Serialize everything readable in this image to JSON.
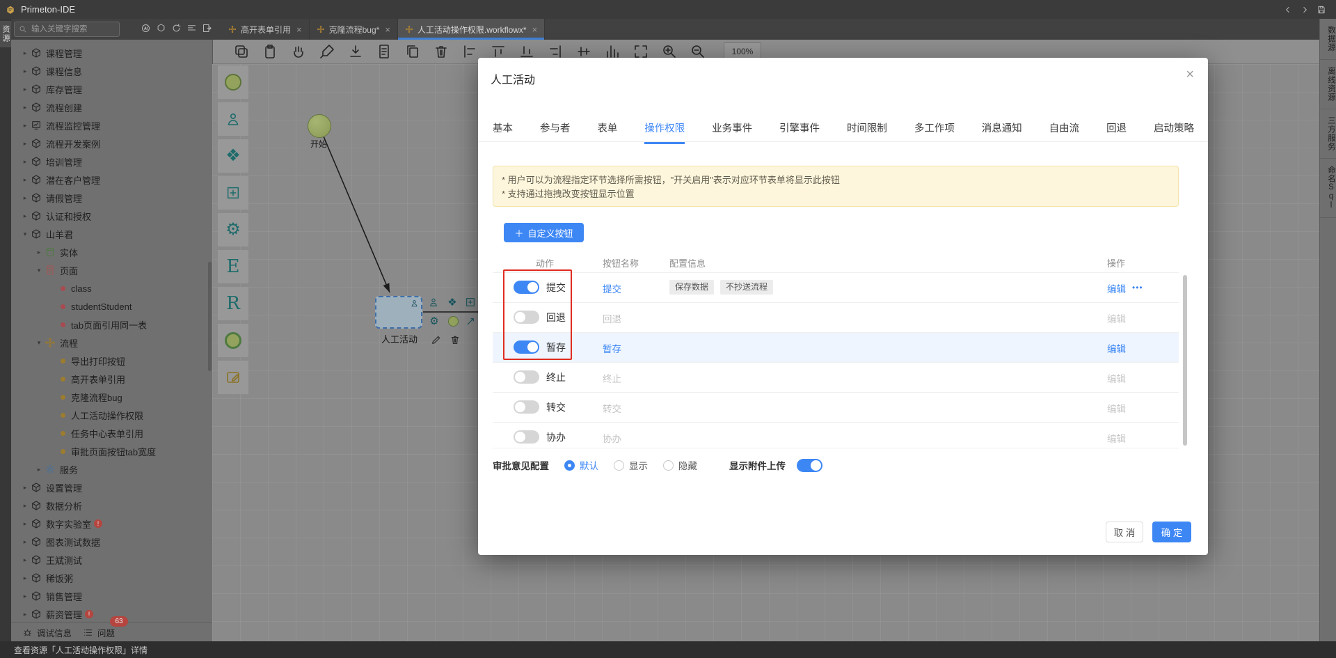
{
  "app": {
    "title": "Primeton-IDE"
  },
  "search": {
    "placeholder": "输入关键字搜索"
  },
  "quick_icons": [
    "ai-icon",
    "hexagon-icon",
    "refresh-icon",
    "outline-icon",
    "export-icon"
  ],
  "editor_tabs": [
    {
      "label": "高开表单引用",
      "active": false
    },
    {
      "label": "克隆流程bug*",
      "active": false
    },
    {
      "label": "人工活动操作权限.workflowx*",
      "active": true
    }
  ],
  "toolbar": {
    "icons": [
      "duplicate-icon",
      "clipboard-icon",
      "hand-icon",
      "brush-icon",
      "download-icon",
      "document-icon",
      "copy-icon",
      "trash-icon",
      "align-left-icon",
      "align-top-icon",
      "align-bottom-icon",
      "align-right-icon",
      "align-middle-icon",
      "distribute-icon",
      "fit-screen-icon",
      "zoom-in-icon",
      "zoom-out-icon"
    ],
    "zoom_level": "100%"
  },
  "left_rail": {
    "active_tab": "资源"
  },
  "sidebar": {
    "items": [
      {
        "level": 0,
        "caret": "r",
        "icon": "cube",
        "label": "课程管理"
      },
      {
        "level": 0,
        "caret": "r",
        "icon": "cube",
        "label": "课程信息"
      },
      {
        "level": 0,
        "caret": "r",
        "icon": "cube",
        "label": "库存管理"
      },
      {
        "level": 0,
        "caret": "r",
        "icon": "cube",
        "label": "流程创建"
      },
      {
        "level": 0,
        "caret": "r",
        "icon": "monitor",
        "label": "流程监控管理"
      },
      {
        "level": 0,
        "caret": "r",
        "icon": "cube",
        "label": "流程开发案例"
      },
      {
        "level": 0,
        "caret": "r",
        "icon": "cube",
        "label": "培训管理"
      },
      {
        "level": 0,
        "caret": "r",
        "icon": "cube",
        "label": "潜在客户管理"
      },
      {
        "level": 0,
        "caret": "r",
        "icon": "cube",
        "label": "请假管理"
      },
      {
        "level": 0,
        "caret": "r",
        "icon": "cube",
        "label": "认证和授权"
      },
      {
        "level": 0,
        "caret": "d",
        "icon": "cube",
        "label": "山羊君"
      },
      {
        "level": 1,
        "caret": "r",
        "icon": "db",
        "label": "实体"
      },
      {
        "level": 1,
        "caret": "d",
        "icon": "page",
        "label": "页面"
      },
      {
        "level": 2,
        "icon": "dot-red",
        "label": "class"
      },
      {
        "level": 2,
        "icon": "dot-red",
        "label": "studentStudent"
      },
      {
        "level": 2,
        "icon": "dot-red",
        "label": "tab页面引用同一表"
      },
      {
        "level": 1,
        "caret": "d",
        "icon": "workflow",
        "label": "流程"
      },
      {
        "level": 2,
        "icon": "dot-orange",
        "label": "导出打印按钮"
      },
      {
        "level": 2,
        "icon": "dot-orange",
        "label": "高开表单引用"
      },
      {
        "level": 2,
        "icon": "dot-orange",
        "label": "克隆流程bug"
      },
      {
        "level": 2,
        "icon": "dot-orange",
        "label": "人工活动操作权限"
      },
      {
        "level": 2,
        "icon": "dot-orange",
        "label": "任务中心表单引用"
      },
      {
        "level": 2,
        "icon": "dot-orange",
        "label": "审批页面按钮tab宽度"
      },
      {
        "level": 1,
        "caret": "r",
        "icon": "gear-blue",
        "label": "服务"
      },
      {
        "level": 0,
        "caret": "r",
        "icon": "cube",
        "label": "设置管理"
      },
      {
        "level": 0,
        "caret": "r",
        "icon": "cube",
        "label": "数据分析"
      },
      {
        "level": 0,
        "caret": "r",
        "icon": "cube",
        "label": "数字实验室",
        "badge": "!"
      },
      {
        "level": 0,
        "caret": "r",
        "icon": "cube",
        "label": "图表测试数据"
      },
      {
        "level": 0,
        "caret": "r",
        "icon": "cube",
        "label": "王斌测试"
      },
      {
        "level": 0,
        "caret": "r",
        "icon": "cube",
        "label": "稀饭粥"
      },
      {
        "level": 0,
        "caret": "r",
        "icon": "cube",
        "label": "销售管理"
      },
      {
        "level": 0,
        "caret": "r",
        "icon": "cube",
        "label": "薪资管理",
        "badge": "!"
      }
    ]
  },
  "bottom_bar": {
    "debug_label": "调试信息",
    "problems_label": "问题",
    "problems_count": "63"
  },
  "status_bar": {
    "text": "查看资源「人工活动操作权限」详情"
  },
  "palette": {
    "items": [
      "start-event",
      "participant",
      "gateway",
      "subprocess",
      "service",
      "entity-E",
      "report-R",
      "end-event",
      "note"
    ]
  },
  "canvas": {
    "start_label": "开始",
    "activity_label": "人工活动",
    "quick_actions_row1": [
      "participant-icon",
      "gateway-icon",
      "subprocess-icon"
    ],
    "quick_actions_row2": [
      "service-icon",
      "end-event-icon",
      "connector-icon"
    ],
    "quick_actions_row3": [
      "edit-icon",
      "delete-icon"
    ]
  },
  "right_panel": {
    "tabs": [
      "数据源",
      "离线资源",
      "三方服务",
      "命名Sql"
    ]
  },
  "dialog": {
    "title": "人工活动",
    "close": "×",
    "tabs": [
      {
        "label": "基本"
      },
      {
        "label": "参与者"
      },
      {
        "label": "表单"
      },
      {
        "label": "操作权限",
        "active": true
      },
      {
        "label": "业务事件"
      },
      {
        "label": "引擎事件"
      },
      {
        "label": "时间限制"
      },
      {
        "label": "多工作项"
      },
      {
        "label": "消息通知"
      },
      {
        "label": "自由流"
      },
      {
        "label": "回退"
      },
      {
        "label": "启动策略"
      }
    ],
    "notice_line1": "* 用户可以为流程指定环节选择所需按钮，\"开关启用\"表示对应环节表单将显示此按钮",
    "notice_line2": "* 支持通过拖拽改变按钮显示位置",
    "custom_button_label": "自定义按钮",
    "table": {
      "headers": {
        "action": "动作",
        "name": "按钮名称",
        "config": "配置信息",
        "ops": "操作"
      },
      "rows": [
        {
          "action": "提交",
          "enabled": true,
          "name": "提交",
          "tags": [
            "保存数据",
            "不抄送流程"
          ],
          "edit_label": "编辑",
          "more": "•••",
          "highlighted": false
        },
        {
          "action": "回退",
          "enabled": false,
          "name": "回退",
          "tags": [],
          "edit_label": "编辑",
          "highlighted": false
        },
        {
          "action": "暂存",
          "enabled": true,
          "name": "暂存",
          "tags": [],
          "edit_label": "编辑",
          "highlighted": true
        },
        {
          "action": "终止",
          "enabled": false,
          "name": "终止",
          "tags": [],
          "edit_label": "编辑",
          "highlighted": false
        },
        {
          "action": "转交",
          "enabled": false,
          "name": "转交",
          "tags": [],
          "edit_label": "编辑",
          "highlighted": false
        },
        {
          "action": "协办",
          "enabled": false,
          "name": "协办",
          "tags": [],
          "edit_label": "编辑",
          "highlighted": false
        }
      ]
    },
    "opinion": {
      "label": "审批意见配置",
      "options": [
        {
          "label": "默认",
          "selected": true
        },
        {
          "label": "显示",
          "selected": false
        },
        {
          "label": "隐藏",
          "selected": false
        }
      ]
    },
    "attachment": {
      "label": "显示附件上传",
      "enabled": true
    },
    "footer": {
      "cancel": "取 消",
      "ok": "确 定"
    },
    "colors": {
      "accent": "#3d87f5",
      "annotation_red": "#e02b20",
      "notice_bg": "#fdf6dc"
    }
  }
}
